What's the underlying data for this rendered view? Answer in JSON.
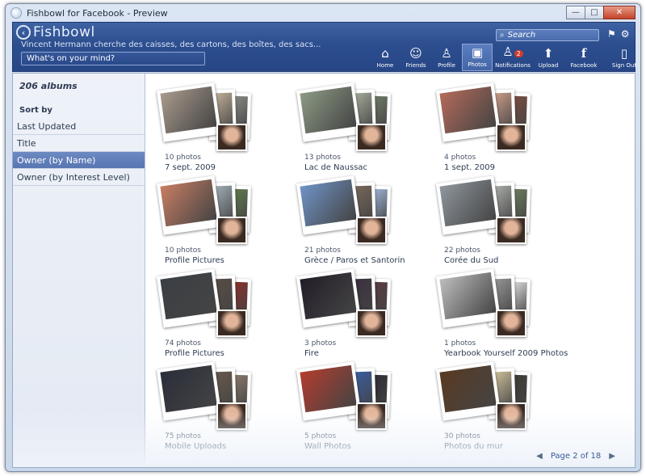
{
  "window": {
    "title": "Fishbowl for Facebook - Preview",
    "controls": [
      "—",
      "□",
      "✕"
    ]
  },
  "header": {
    "logo_text": "Fishbowl",
    "status_line": "Vincent Hermann cherche des caisses, des cartons, des boîtes, des sacs...",
    "status_input_placeholder": "What's on your mind?",
    "search_placeholder": "Search",
    "nav": [
      {
        "label": "Home",
        "icon": "home-icon"
      },
      {
        "label": "Friends",
        "icon": "friends-icon"
      },
      {
        "label": "Profile",
        "icon": "profile-icon"
      },
      {
        "label": "Photos",
        "icon": "photos-icon",
        "active": true
      },
      {
        "label": "Notifications",
        "icon": "notifications-icon",
        "badge": "2"
      },
      {
        "label": "Upload",
        "icon": "upload-icon"
      },
      {
        "label": "Facebook",
        "icon": "facebook-icon"
      },
      {
        "label": "Sign Out",
        "icon": "sign-out-icon"
      }
    ]
  },
  "sidebar": {
    "albums_count": "206 albums",
    "sort_by_label": "Sort by",
    "sort_options": [
      {
        "label": "Last Updated"
      },
      {
        "label": "Title"
      },
      {
        "label": "Owner (by Name)",
        "active": true
      },
      {
        "label": "Owner (by Interest Level)"
      }
    ]
  },
  "albums": [
    {
      "count": "10 photos",
      "name": "7 sept. 2009",
      "colors": [
        "#a99a8c",
        "#c9b79e",
        "#8a8b86"
      ]
    },
    {
      "count": "13 photos",
      "name": "Lac de Naussac",
      "colors": [
        "#8c9a84",
        "#aab3a0",
        "#6f7a67"
      ]
    },
    {
      "count": "4 photos",
      "name": "1 sept. 2009",
      "colors": [
        "#b46a5a",
        "#d6a48e",
        "#7a4d42"
      ]
    },
    {
      "count": "10 photos",
      "name": "Profile Pictures",
      "colors": [
        "#c77d63",
        "#a8b6bf",
        "#5f7a4e"
      ]
    },
    {
      "count": "21 photos",
      "name": "Grèce / Paros et Santorin",
      "colors": [
        "#6f93c6",
        "#7c6a5c",
        "#9fb6d8"
      ]
    },
    {
      "count": "22 photos",
      "name": "Corée du Sud",
      "colors": [
        "#8e969d",
        "#b2b5b0",
        "#6b7d5e"
      ]
    },
    {
      "count": "74 photos",
      "name": "Profile Pictures",
      "colors": [
        "#3b3f44",
        "#5a4d45",
        "#8a2f2b"
      ]
    },
    {
      "count": "3 photos",
      "name": "Fire",
      "colors": [
        "#221d28",
        "#3a2f3e",
        "#5b3b44"
      ]
    },
    {
      "count": "1 photos",
      "name": "Yearbook Yourself 2009 Photos",
      "colors": [
        "#bdbdbd",
        "#9c9c9c",
        "#dedede"
      ]
    },
    {
      "count": "75 photos",
      "name": "Mobile Uploads",
      "colors": [
        "#2a2d3a",
        "#6b5a4d",
        "#8b7a6a"
      ]
    },
    {
      "count": "5 photos",
      "name": "Wall Photos",
      "colors": [
        "#b43c2e",
        "#3a5fa8",
        "#2d2d33"
      ]
    },
    {
      "count": "30 photos",
      "name": "Photos du mur",
      "colors": [
        "#5a3a22",
        "#d9c9a1",
        "#3f3a35"
      ]
    }
  ],
  "pager": {
    "label": "Page 2 of 18",
    "prev_icon": "prev-page-icon",
    "next_icon": "next-page-icon"
  }
}
